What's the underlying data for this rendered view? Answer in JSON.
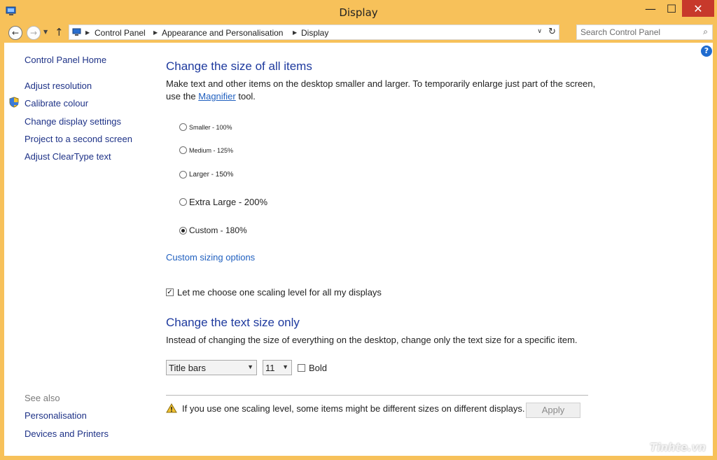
{
  "window": {
    "title": "Display",
    "minimize_glyph": "—",
    "maximize_glyph": "☐",
    "close_glyph": "✕"
  },
  "navbar": {
    "back_glyph": "←",
    "forward_glyph": "→",
    "recent_glyph": "▼",
    "up_glyph": "↑",
    "breadcrumb": [
      "Control Panel",
      "Appearance and Personalisation",
      "Display"
    ],
    "separator_glyph": "▶",
    "dropdown_glyph": "∨",
    "refresh_glyph": "↻",
    "search_placeholder": "Search Control Panel",
    "search_glyph": "⌕"
  },
  "help": {
    "glyph": "?"
  },
  "sidebar": {
    "home": "Control Panel Home",
    "items": [
      "Adjust resolution",
      "Calibrate colour",
      "Change display settings",
      "Project to a second screen",
      "Adjust ClearType text"
    ],
    "see_also_label": "See also",
    "see_also": [
      "Personalisation",
      "Devices and Printers"
    ]
  },
  "main": {
    "heading1": "Change the size of all items",
    "desc1_part1": "Make text and other items on the desktop smaller and larger. To temporarily enlarge just part of the screen, use the ",
    "desc1_link": "Magnifier",
    "desc1_part2": " tool.",
    "options": [
      {
        "label": "Smaller - 100%",
        "selected": false
      },
      {
        "label": "Medium - 125%",
        "selected": false
      },
      {
        "label": "Larger - 150%",
        "selected": false
      },
      {
        "label": "Extra Large - 200%",
        "selected": false
      },
      {
        "label": "Custom - 180%",
        "selected": true
      }
    ],
    "custom_sizing_link": "Custom sizing options",
    "scaling_checkbox_label": "Let me choose one scaling level for all my displays",
    "scaling_checkbox_checked": true,
    "heading2": "Change the text size only",
    "desc2": "Instead of changing the size of everything on the desktop, change only the text size for a specific item.",
    "item_select": "Title bars",
    "size_select": "11",
    "bold_label": "Bold",
    "bold_checked": false,
    "warning_text": "If you use one scaling level, some items might be different sizes on different displays.",
    "apply_label": "Apply"
  },
  "watermark": "Tinhte.vn",
  "colors": {
    "titlebar": "#f7c15a",
    "close": "#c7392b",
    "heading": "#1e3a9e",
    "link": "#1f5fbf",
    "sidebar_link": "#1e3287"
  }
}
